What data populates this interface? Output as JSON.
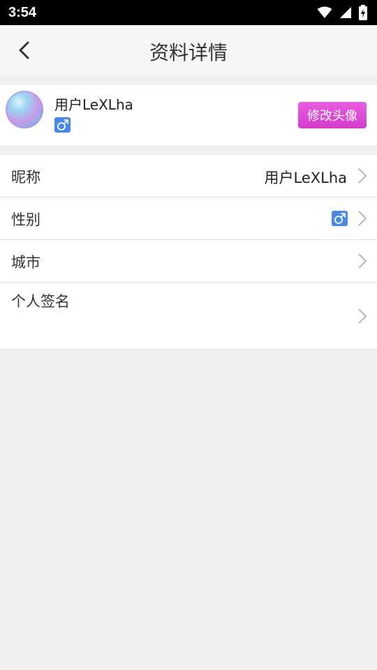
{
  "status_bar": {
    "time": "3:54",
    "icons": [
      "wifi-icon",
      "signal-icon",
      "battery-charging-icon"
    ]
  },
  "header": {
    "back_icon": "chevron-left-icon",
    "title": "资料详情"
  },
  "profile": {
    "name": "用户LeXLha",
    "gender_symbol": "♂",
    "change_avatar_label": "修改头像"
  },
  "fields": [
    {
      "label": "昵称",
      "value": "用户LeXLha"
    },
    {
      "label": "性别",
      "value": "♂"
    },
    {
      "label": "城市",
      "value": ""
    },
    {
      "label": "个人签名",
      "value": ""
    }
  ],
  "colors": {
    "accent": "#d94bd3",
    "gender_male": "#4a88e8",
    "page_background": "#f0f0f0"
  }
}
